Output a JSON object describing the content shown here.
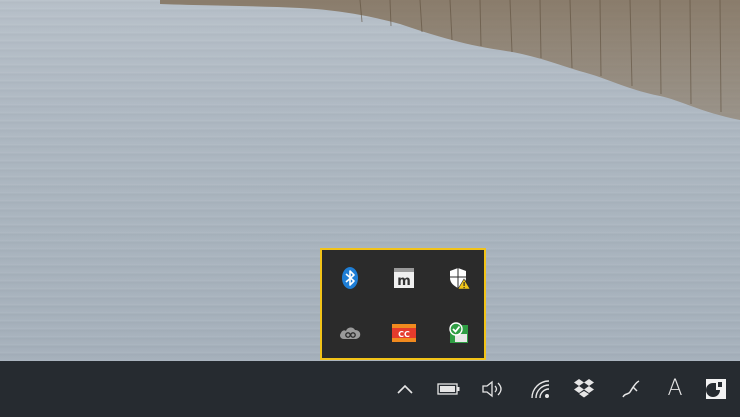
{
  "desktop": {
    "wallpaper": "lake-with-reeds",
    "colors": {
      "water": "#aeb8c2",
      "reeds": "#7a6a55"
    }
  },
  "tray_flyout": {
    "highlight_color": "#f2c318",
    "icons": [
      {
        "name": "bluetooth-icon",
        "color": "#1e7ed6"
      },
      {
        "name": "mailbird-icon",
        "color": "#e8e8e8"
      },
      {
        "name": "windows-security-warning-icon",
        "color": "#f0c419"
      },
      {
        "name": "creative-cloud-icon",
        "color": "#9a9a9a"
      },
      {
        "name": "cc-app-icon",
        "color": "#e53b2c"
      },
      {
        "name": "update-check-icon",
        "color": "#2f9e44"
      }
    ]
  },
  "taskbar": {
    "background": "#262b30",
    "tray_icons": [
      {
        "name": "chevron-up-icon"
      },
      {
        "name": "battery-icon"
      },
      {
        "name": "volume-icon"
      },
      {
        "name": "wifi-icon"
      },
      {
        "name": "dropbox-icon"
      },
      {
        "name": "pen-workspace-icon"
      },
      {
        "label": "A",
        "name": "input-language-icon"
      },
      {
        "name": "notification-center-icon"
      }
    ]
  }
}
